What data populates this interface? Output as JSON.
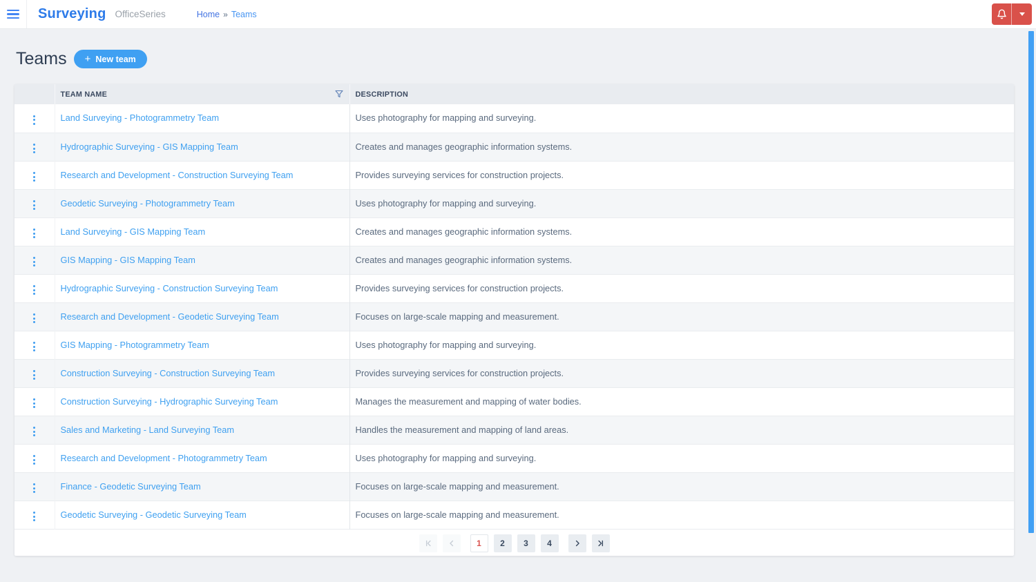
{
  "topbar": {
    "app_title": "Surveying",
    "app_subtitle": "OfficeSeries",
    "breadcrumb": {
      "home": "Home",
      "separator": "»",
      "current": "Teams"
    },
    "icons": {
      "menu": "☰ hamburger",
      "notifications": "🔔 bell outline",
      "account": "▾ caret-down"
    }
  },
  "page": {
    "title": "Teams",
    "new_team_button": {
      "plus": "+",
      "label": "New team"
    }
  },
  "table": {
    "columns": {
      "name_label": "TEAM NAME",
      "description_label": "DESCRIPTION",
      "name_filter_icon": "funnel-filter"
    },
    "row_actions_icon": "⋮ kebab-menu",
    "rows": [
      {
        "name": "Land Surveying - Photogrammetry Team",
        "description": "Uses photography for mapping and surveying."
      },
      {
        "name": "Hydrographic Surveying - GIS Mapping Team",
        "description": "Creates and manages geographic information systems."
      },
      {
        "name": "Research and Development - Construction Surveying Team",
        "description": "Provides surveying services for construction projects."
      },
      {
        "name": "Geodetic Surveying - Photogrammetry Team",
        "description": "Uses photography for mapping and surveying."
      },
      {
        "name": "Land Surveying - GIS Mapping Team",
        "description": "Creates and manages geographic information systems."
      },
      {
        "name": "GIS Mapping - GIS Mapping Team",
        "description": "Creates and manages geographic information systems."
      },
      {
        "name": "Hydrographic Surveying - Construction Surveying Team",
        "description": "Provides surveying services for construction projects."
      },
      {
        "name": "Research and Development - Geodetic Surveying Team",
        "description": "Focuses on large-scale mapping and measurement."
      },
      {
        "name": "GIS Mapping - Photogrammetry Team",
        "description": "Uses photography for mapping and surveying."
      },
      {
        "name": "Construction Surveying - Construction Surveying Team",
        "description": "Provides surveying services for construction projects."
      },
      {
        "name": "Construction Surveying - Hydrographic Surveying Team",
        "description": "Manages the measurement and mapping of water bodies."
      },
      {
        "name": "Sales and Marketing - Land Surveying Team",
        "description": "Handles the measurement and mapping of land areas."
      },
      {
        "name": "Research and Development - Photogrammetry Team",
        "description": "Uses photography for mapping and surveying."
      },
      {
        "name": "Finance - Geodetic Surveying Team",
        "description": "Focuses on large-scale mapping and measurement."
      },
      {
        "name": "Geodetic Surveying - Geodetic Surveying Team",
        "description": "Focuses on large-scale mapping and measurement."
      }
    ]
  },
  "pagination": {
    "first_icon": "|<",
    "prev_icon": "<",
    "pages": [
      "1",
      "2",
      "3",
      "4"
    ],
    "active_page": "1",
    "next_icon": ">",
    "last_icon": ">|"
  },
  "colors": {
    "brand_blue": "#2d7be9",
    "accent_blue": "#3fa0f2",
    "link_blue": "#3fa0f0",
    "alert_red": "#d9514a",
    "active_page_red": "#d9534f",
    "scrollbar_blue": "#41a0f4",
    "page_background": "#eff1f4",
    "table_header_bg": "#e9ecf0"
  }
}
